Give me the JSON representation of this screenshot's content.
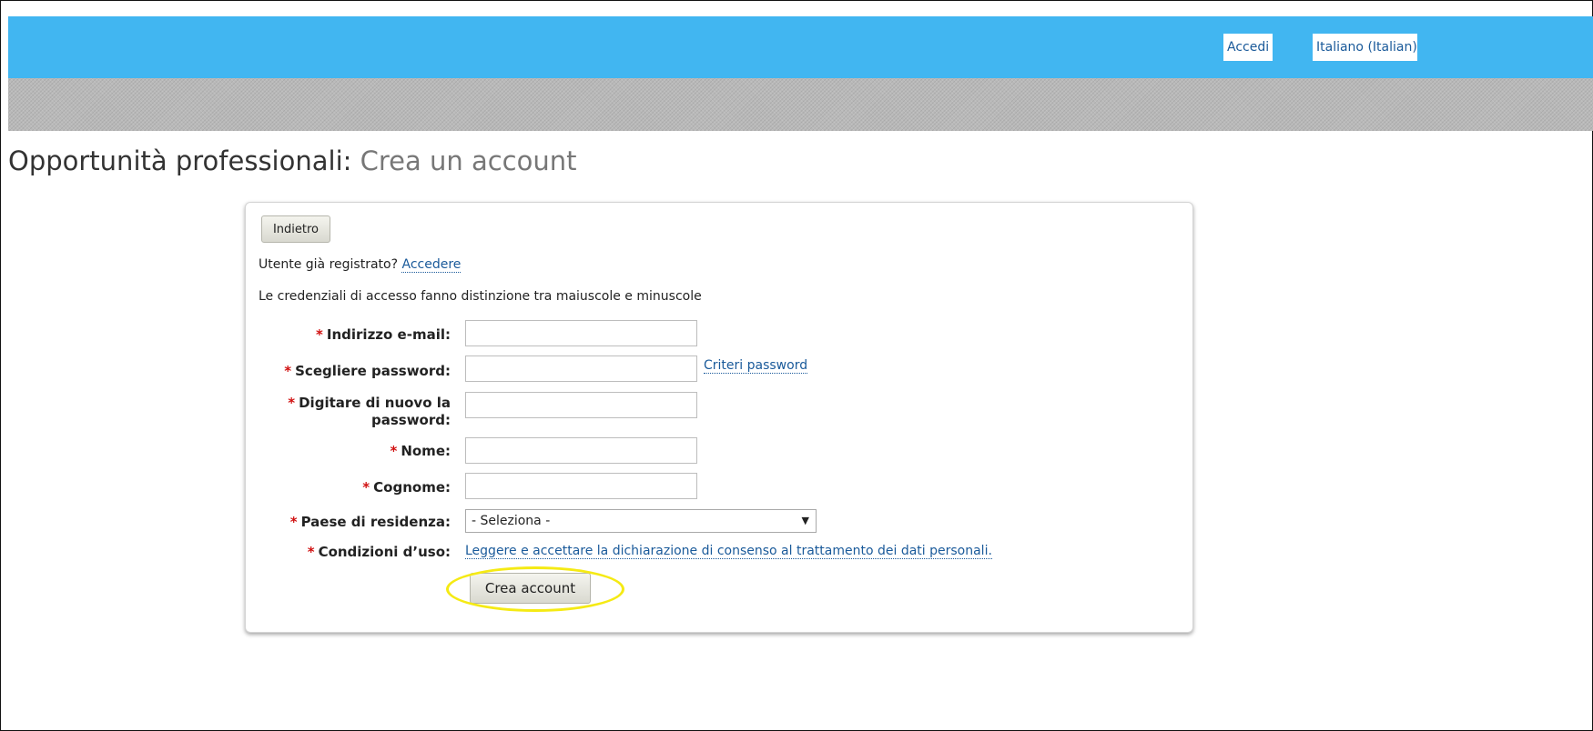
{
  "header": {
    "login_link": "Accedi",
    "language_link": "Italiano (Italian)"
  },
  "page": {
    "title": "Opportunità professionali:",
    "subtitle": "Crea un account"
  },
  "form": {
    "back_button": "Indietro",
    "already_registered_text": "Utente già registrato?",
    "login_link": "Accedere",
    "case_sensitive_note": "Le credenziali di accesso fanno distinzione tra maiuscole e minuscole",
    "required_marker": "*",
    "fields": {
      "email": {
        "label": "Indirizzo e-mail:",
        "value": ""
      },
      "password": {
        "label": "Scegliere password:",
        "value": ""
      },
      "password_confirm": {
        "label_line1": "Digitare di nuovo la",
        "label_line2": "password:",
        "value": ""
      },
      "first_name": {
        "label": "Nome:",
        "value": ""
      },
      "last_name": {
        "label": "Cognome:",
        "value": ""
      },
      "country": {
        "label": "Paese di residenza:",
        "selected": "- Seleziona -"
      },
      "terms": {
        "label": "Condizioni d’uso:",
        "link": "Leggere e accettare la dichiarazione di consenso al trattamento dei dati personali."
      }
    },
    "password_criteria_link": "Criteri password",
    "submit_button": "Crea account"
  },
  "colors": {
    "topbar": "#41b6f1",
    "required": "#d01010",
    "link": "#1a5a9a",
    "highlight": "#f5ea14"
  },
  "icons": {
    "dropdown": "chevron-down-icon"
  }
}
